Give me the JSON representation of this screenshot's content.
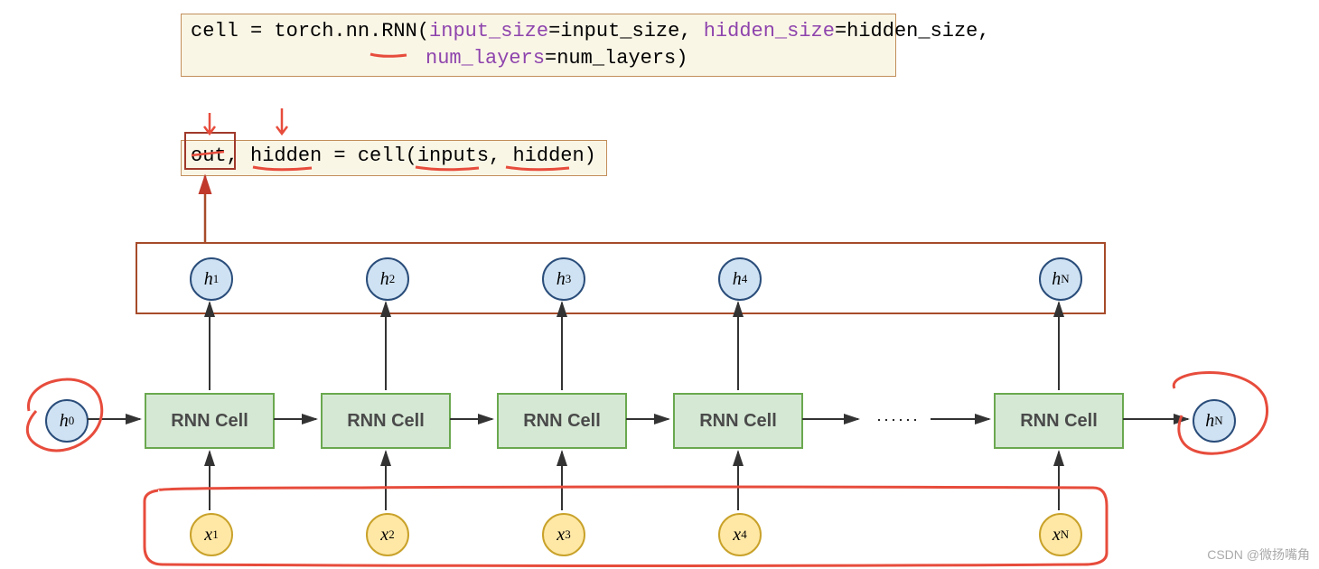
{
  "code1": {
    "prefix": "cell = torch.nn.RNN(",
    "arg1k": "input_size",
    "arg1v": "=input_size, ",
    "arg2k": "hidden_size",
    "arg2v": "=hidden_size,",
    "arg3k": "num_layers",
    "arg3v": "=num_layers)"
  },
  "code2": {
    "text": "out, hidden = cell(inputs, hidden)"
  },
  "cells": [
    "RNN Cell",
    "RNN Cell",
    "RNN Cell",
    "RNN Cell",
    "RNN Cell"
  ],
  "h_nodes": [
    "h",
    "h",
    "h",
    "h",
    "h",
    "h",
    "h"
  ],
  "h_subs": [
    "0",
    "1",
    "2",
    "3",
    "4",
    "N",
    "N"
  ],
  "x_nodes": [
    "x",
    "x",
    "x",
    "x",
    "x"
  ],
  "x_subs": [
    "1",
    "2",
    "3",
    "4",
    "N"
  ],
  "dots": "······",
  "watermark": "CSDN @微扬嘴角"
}
